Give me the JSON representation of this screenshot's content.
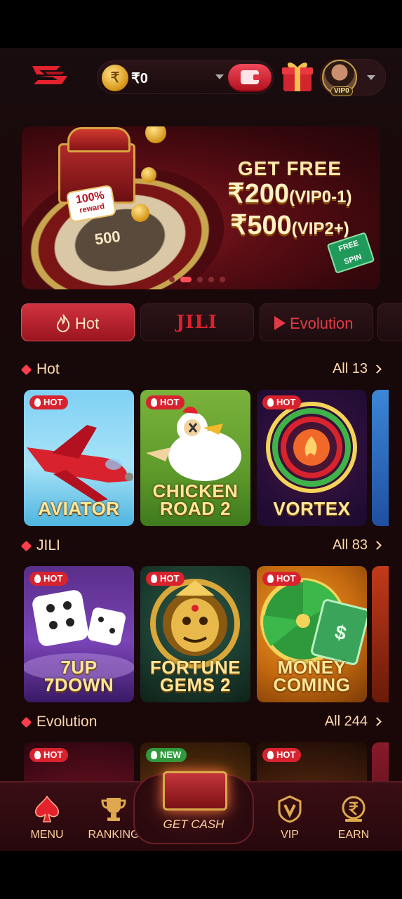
{
  "header": {
    "currency_symbol": "₹",
    "balance": "₹0",
    "vip_level": "VIP0"
  },
  "banner": {
    "reward_badge_percent": "100%",
    "reward_badge_text": "reward",
    "wheel_number": "500",
    "headline": "GET FREE",
    "line2_amount": "₹200",
    "line2_note": "(VIP0-1)",
    "line3_amount": "₹500",
    "line3_note": "(VIP2+)",
    "free_spin": "FREE SPIN",
    "slides": 5,
    "active_slide": 1
  },
  "tabs": [
    {
      "label": "Hot",
      "active": true
    },
    {
      "label": "JILI",
      "active": false
    },
    {
      "label": "Evolution",
      "active": false
    }
  ],
  "sections": [
    {
      "title": "Hot",
      "all_label": "All 13",
      "games": [
        {
          "name": "AVIATOR",
          "badge": "HOT"
        },
        {
          "name": "CHICKEN ROAD 2",
          "badge": "HOT"
        },
        {
          "name": "VORTEX",
          "badge": "HOT"
        }
      ]
    },
    {
      "title": "JILI",
      "all_label": "All 83",
      "games": [
        {
          "name": "7UP 7DOWN",
          "badge": "HOT"
        },
        {
          "name": "FORTUNE GEMS 2",
          "badge": "HOT"
        },
        {
          "name": "MONEY COMING",
          "badge": "HOT"
        }
      ]
    },
    {
      "title": "Evolution",
      "all_label": "All 244",
      "games": [
        {
          "name": "",
          "badge": "HOT"
        },
        {
          "name": "",
          "badge": "NEW"
        },
        {
          "name": "",
          "badge": "HOT"
        }
      ]
    }
  ],
  "bottom_nav": {
    "menu": "MENU",
    "ranking": "RANKING",
    "get_cash": "GET CASH",
    "vip": "VIP",
    "earn": "EARN"
  },
  "colors": {
    "accent": "#d8232f",
    "gold_text": "#ffe79a",
    "section_text": "#ffd9b0",
    "background": "#1a0a0c"
  }
}
